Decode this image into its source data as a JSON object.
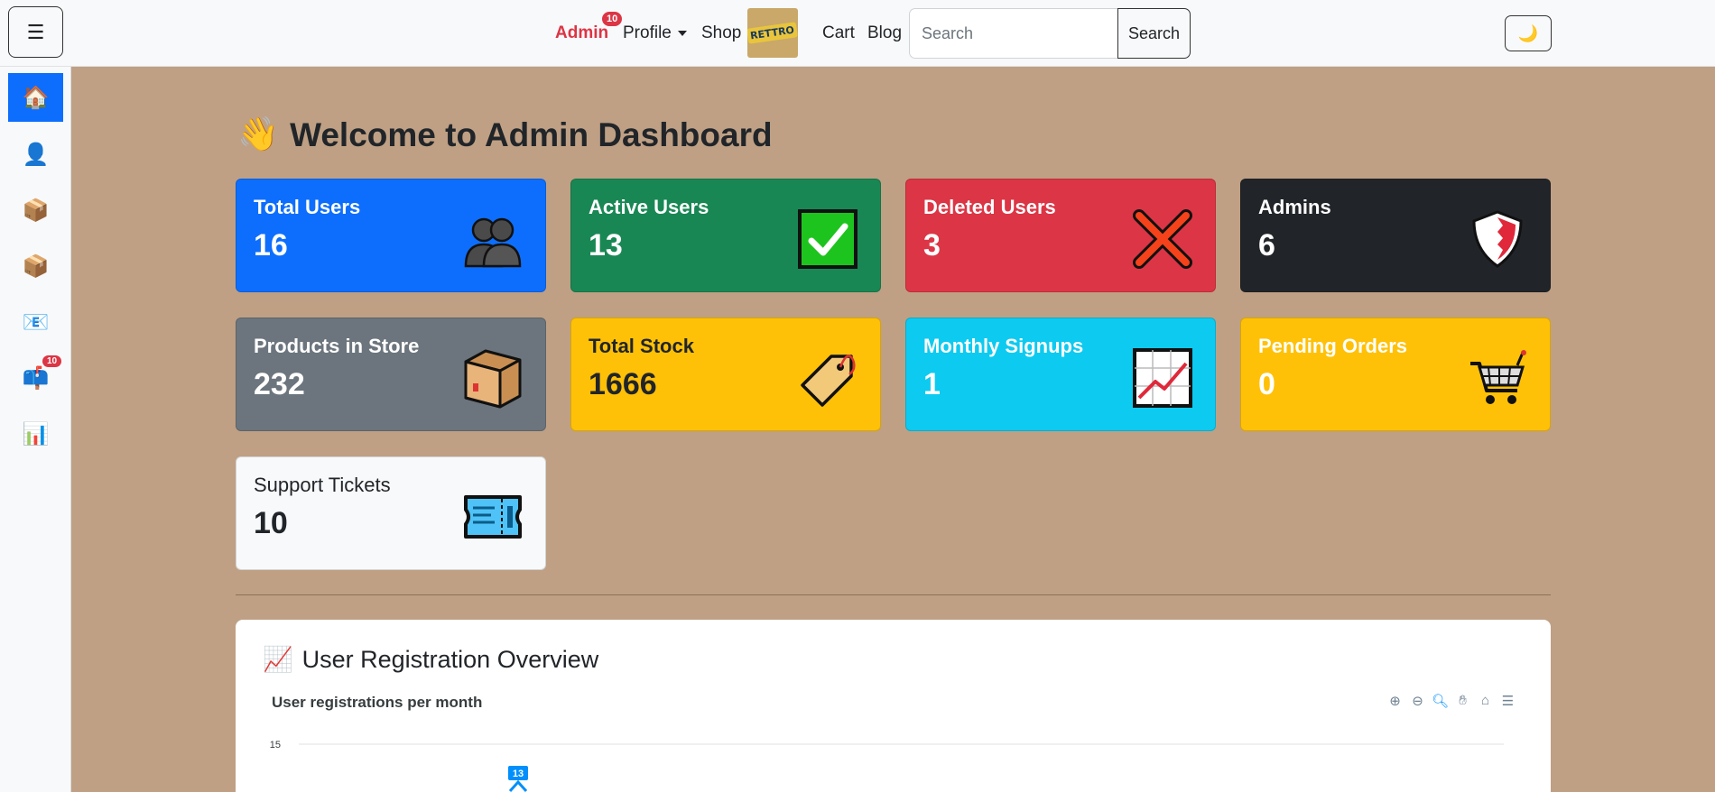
{
  "nav": {
    "admin_label": "Admin",
    "admin_badge": "10",
    "profile_label": "Profile",
    "shop_label": "Shop",
    "logo_text": "RETTRO",
    "cart_label": "Cart",
    "blog_label": "Blog",
    "search_placeholder": "Search",
    "search_button": "Search",
    "menu_toggle_glyph": "☰",
    "theme_icon": "🌙"
  },
  "sidebar": {
    "items": [
      {
        "icon": "🏠",
        "name": "home-icon",
        "active": true
      },
      {
        "icon": "👤",
        "name": "user-icon"
      },
      {
        "icon": "📦",
        "name": "box-icon"
      },
      {
        "icon": "📦",
        "name": "box-icon"
      },
      {
        "icon": "📧",
        "name": "mail-icon"
      },
      {
        "icon": "📫",
        "name": "mailbox-icon",
        "badge": "10"
      },
      {
        "icon": "📊",
        "name": "chart-icon"
      }
    ]
  },
  "main": {
    "title_icon": "👋",
    "title": "Welcome to Admin Dashboard",
    "cards": [
      {
        "title": "Total Users",
        "value": "16",
        "icon": "users-icon"
      },
      {
        "title": "Active Users",
        "value": "13",
        "icon": "check-icon"
      },
      {
        "title": "Deleted Users",
        "value": "3",
        "icon": "cross-icon"
      },
      {
        "title": "Admins",
        "value": "6",
        "icon": "shield-icon"
      },
      {
        "title": "Products in Store",
        "value": "232",
        "icon": "box-icon"
      },
      {
        "title": "Total Stock",
        "value": "1666",
        "icon": "tag-icon"
      },
      {
        "title": "Monthly Signups",
        "value": "1",
        "icon": "chart-up-icon"
      },
      {
        "title": "Pending Orders",
        "value": "0",
        "icon": "cart-icon"
      },
      {
        "title": "Support Tickets",
        "value": "10",
        "icon": "ticket-icon"
      }
    ]
  },
  "chart_section": {
    "heading_icon": "📈",
    "heading": "User Registration Overview",
    "subtitle": "User registrations per month"
  },
  "chart_data": {
    "type": "line",
    "title": "User registrations per month",
    "yticks": [
      15
    ],
    "data_labels": [
      13
    ],
    "series": [
      {
        "values": [
          13
        ]
      }
    ]
  }
}
